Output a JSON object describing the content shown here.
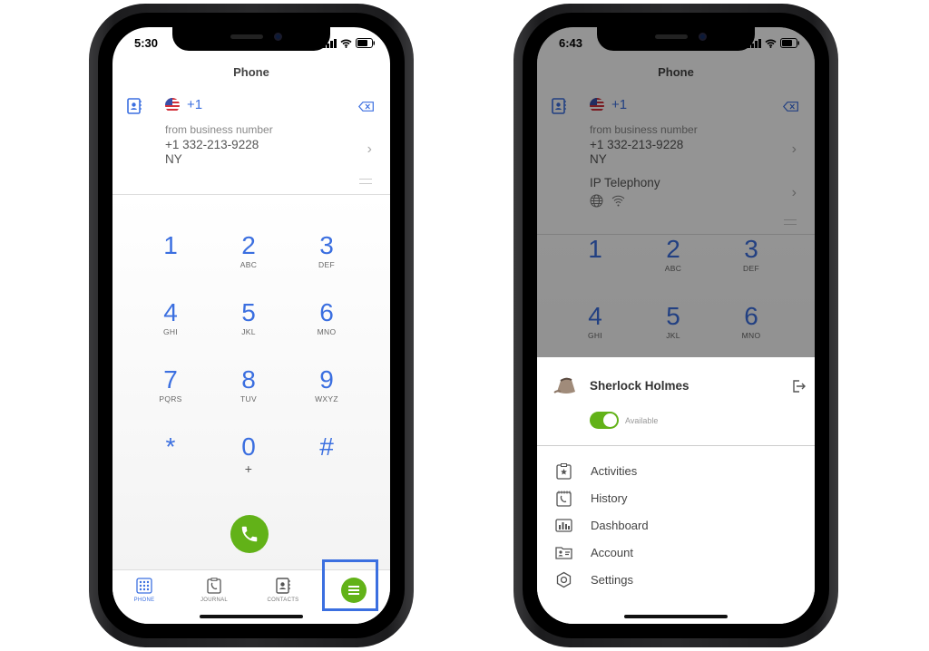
{
  "left_phone": {
    "status": {
      "time": "5:30"
    },
    "title": "Phone",
    "dial": {
      "country_code": "+1",
      "from_label": "from business number",
      "number": "+1 332-213-9228",
      "region": "NY"
    },
    "keys": [
      {
        "digit": "1",
        "letters": ""
      },
      {
        "digit": "2",
        "letters": "ABC"
      },
      {
        "digit": "3",
        "letters": "DEF"
      },
      {
        "digit": "4",
        "letters": "GHI"
      },
      {
        "digit": "5",
        "letters": "JKL"
      },
      {
        "digit": "6",
        "letters": "MNO"
      },
      {
        "digit": "7",
        "letters": "PQRS"
      },
      {
        "digit": "8",
        "letters": "TUV"
      },
      {
        "digit": "9",
        "letters": "WXYZ"
      },
      {
        "digit": "*",
        "letters": ""
      },
      {
        "digit": "0",
        "letters": "+"
      },
      {
        "digit": "#",
        "letters": ""
      }
    ],
    "tabs": [
      {
        "label": "PHONE",
        "icon": "dialpad-icon",
        "active": true
      },
      {
        "label": "JOURNAL",
        "icon": "journal-icon",
        "active": false
      },
      {
        "label": "CONTACTS",
        "icon": "contacts-icon",
        "active": false
      }
    ],
    "menu_icon": "menu-icon"
  },
  "right_phone": {
    "status": {
      "time": "6:43"
    },
    "title": "Phone",
    "dial": {
      "country_code": "+1",
      "from_label": "from business number",
      "number": "+1 332-213-9228",
      "region": "NY",
      "line_label": "IP Telephony"
    },
    "keys": [
      {
        "digit": "1",
        "letters": ""
      },
      {
        "digit": "2",
        "letters": "ABC"
      },
      {
        "digit": "3",
        "letters": "DEF"
      },
      {
        "digit": "4",
        "letters": "GHI"
      },
      {
        "digit": "5",
        "letters": "JKL"
      },
      {
        "digit": "6",
        "letters": "MNO"
      }
    ],
    "user": {
      "name": "Sherlock Holmes",
      "status": "Available",
      "available": true
    },
    "menu": [
      {
        "label": "Activities",
        "icon": "activities-icon"
      },
      {
        "label": "History",
        "icon": "history-icon"
      },
      {
        "label": "Dashboard",
        "icon": "dashboard-icon"
      },
      {
        "label": "Account",
        "icon": "account-icon"
      },
      {
        "label": "Settings",
        "icon": "settings-icon"
      }
    ]
  },
  "colors": {
    "accent": "#3b6fe0",
    "green": "#62b218"
  }
}
